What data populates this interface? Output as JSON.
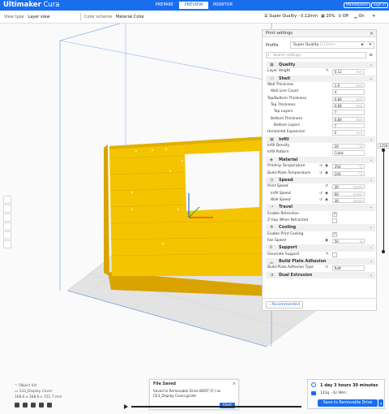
{
  "app": {
    "name_bold": "Ultimaker",
    "name_thin": " Cura"
  },
  "stages": [
    "PREPARE",
    "PREVIEW",
    "MONITOR"
  ],
  "top_buttons": {
    "marketplace": "Marketplace",
    "signin": "Sign in"
  },
  "viewbar": {
    "view_type_label": "View type",
    "view_type_value": "Layer view",
    "color_scheme_label": "Color scheme",
    "color_scheme_value": "Material Color",
    "quality": "Super Quality - 0.12mm",
    "infill": "20%",
    "support": "Off",
    "adhesion": "On"
  },
  "layer_slider": {
    "value": "1258"
  },
  "print_settings": {
    "title": "Print settings",
    "profile_label": "Profile",
    "profile_value": "Super Quality",
    "profile_sub": "0.12mm",
    "search_placeholder": "Search settings",
    "recommended_label": "Recommended"
  },
  "settings": [
    {
      "type": "cat",
      "label": "Quality"
    },
    {
      "type": "val",
      "label": "Layer Height",
      "value": "0.12",
      "unit": "mm",
      "indent": 0,
      "icons": "link"
    },
    {
      "type": "cat",
      "label": "Shell"
    },
    {
      "type": "val",
      "label": "Wall Thickness",
      "value": "1.6",
      "unit": "mm",
      "indent": 0
    },
    {
      "type": "val",
      "label": "Wall Line Count",
      "value": "4",
      "unit": "",
      "indent": 1
    },
    {
      "type": "val",
      "label": "Top/Bottom Thickness",
      "value": "0.84",
      "unit": "mm",
      "indent": 0
    },
    {
      "type": "val",
      "label": "Top Thickness",
      "value": "0.84",
      "unit": "mm",
      "indent": 1
    },
    {
      "type": "val",
      "label": "Top Layers",
      "value": "7",
      "unit": "",
      "indent": 2
    },
    {
      "type": "val",
      "label": "Bottom Thickness",
      "value": "0.84",
      "unit": "mm",
      "indent": 1
    },
    {
      "type": "val",
      "label": "Bottom Layers",
      "value": "7",
      "unit": "",
      "indent": 2
    },
    {
      "type": "val",
      "label": "Horizontal Expansion",
      "value": "0",
      "unit": "mm",
      "indent": 0
    },
    {
      "type": "cat",
      "label": "Infill"
    },
    {
      "type": "val",
      "label": "Infill Density",
      "value": "20",
      "unit": "%",
      "indent": 0
    },
    {
      "type": "val",
      "label": "Infill Pattern",
      "value": "Cubic",
      "unit": "",
      "indent": 0
    },
    {
      "type": "cat",
      "label": "Material"
    },
    {
      "type": "val",
      "label": "Printing Temperature",
      "value": "250",
      "unit": "°C",
      "indent": 0,
      "em": true,
      "icons": "reset"
    },
    {
      "type": "val",
      "label": "Build Plate Temperature",
      "value": "100",
      "unit": "°C",
      "indent": 0,
      "em": true,
      "icons": "reset"
    },
    {
      "type": "cat",
      "label": "Speed"
    },
    {
      "type": "val",
      "label": "Print Speed",
      "value": "30",
      "unit": "mm/s",
      "indent": 0,
      "em": true,
      "icons": "reset1"
    },
    {
      "type": "val",
      "label": "Infill Speed",
      "value": "60",
      "unit": "mm/s",
      "indent": 1,
      "em": true,
      "icons": "reset"
    },
    {
      "type": "val",
      "label": "Wall Speed",
      "value": "30",
      "unit": "mm/s",
      "indent": 1,
      "em": true,
      "icons": "reset"
    },
    {
      "type": "cat",
      "label": "Travel"
    },
    {
      "type": "chk",
      "label": "Enable Retraction",
      "checked": true,
      "indent": 0
    },
    {
      "type": "chk",
      "label": "Z Hop When Retracted",
      "checked": false,
      "indent": 0
    },
    {
      "type": "cat",
      "label": "Cooling"
    },
    {
      "type": "chk",
      "label": "Enable Print Cooling",
      "checked": true,
      "indent": 0
    },
    {
      "type": "val",
      "label": "Fan Speed",
      "value": "50",
      "unit": "%",
      "indent": 0,
      "icons": "info"
    },
    {
      "type": "cat",
      "label": "Support"
    },
    {
      "type": "chk",
      "label": "Generate Support",
      "checked": false,
      "indent": 0,
      "icons": "link"
    },
    {
      "type": "cat",
      "label": "Build Plate Adhesion"
    },
    {
      "type": "val",
      "label": "Build Plate Adhesion Type",
      "value": "Raft",
      "unit": "",
      "indent": 0,
      "em": true,
      "icons": "reset1"
    },
    {
      "type": "cat",
      "label": "Dual Extrusion"
    }
  ],
  "object_info": {
    "title": "Object list",
    "name": "133_Display Cover",
    "dimensions": "168.6 x 168.6 x 151.7 mm"
  },
  "toast": {
    "title": "File Saved",
    "message": "Saved to Removable Drive BOOT (F:) as CE3_Display Cover.gcode",
    "button": "Eject"
  },
  "print_info": {
    "time": "1 day 3 hours 30 minutes",
    "material": "143g · 42.98m",
    "save_button": "Save to Removable Drive"
  },
  "colors": {
    "accent": "#196ef0",
    "model": "#f5c400",
    "model_dark": "#d9a300"
  }
}
